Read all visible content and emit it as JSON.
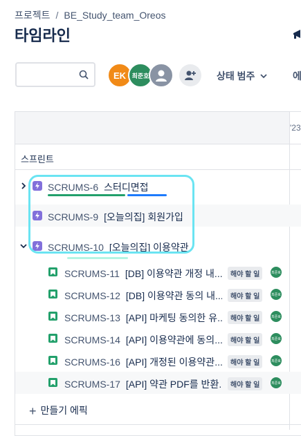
{
  "breadcrumb": {
    "projects": "프로젝트",
    "separator": "/",
    "project_name": "BE_Study_team_Oreos"
  },
  "page": {
    "title": "타임라인"
  },
  "toolbar": {
    "search_placeholder": "",
    "avatars": [
      {
        "initials": "EK",
        "color": "#f18a17"
      },
      {
        "initials": "최준호",
        "color": "#2d8d5e"
      },
      {
        "initials": "",
        "color": "#8993a4"
      }
    ],
    "status_filter": "상태 범주",
    "more_filter": "에"
  },
  "timeline": {
    "month_label": "'23",
    "sprint_label": "스프린트",
    "create_epic": "만들기 에픽",
    "epics": [
      {
        "key": "SCRUMS-6",
        "title": "스터디면접",
        "expanded": false
      },
      {
        "key": "SCRUMS-9",
        "title": "[오늘의집] 회원가입",
        "expanded": false
      },
      {
        "key": "SCRUMS-10",
        "title": "[오늘의집] 이용약관",
        "expanded": true
      }
    ],
    "issues": [
      {
        "key": "SCRUMS-11",
        "title": "[DB] 이용약관 개정 내...",
        "status": "해야 할 일",
        "assignee": "최준호"
      },
      {
        "key": "SCRUMS-12",
        "title": "[DB] 이용약관 동의 내...",
        "status": "해야 할 일",
        "assignee": "최준호"
      },
      {
        "key": "SCRUMS-13",
        "title": "[API] 마케팅 동의한 유...",
        "status": "해야 할 일",
        "assignee": "최준호"
      },
      {
        "key": "SCRUMS-14",
        "title": "[API] 이용약관에 동의...",
        "status": "해야 할 일",
        "assignee": "최준호"
      },
      {
        "key": "SCRUMS-16",
        "title": "[API] 개정된 이용약관...",
        "status": "해야 할 일",
        "assignee": "최준호"
      },
      {
        "key": "SCRUMS-17",
        "title": "[API] 약관 PDF를 반환...",
        "status": "해야 할 일",
        "assignee": "최준호"
      }
    ]
  },
  "colors": {
    "epic": "#8270db",
    "story": "#22a06b",
    "highlight": "#6ae4f2",
    "progress_done": "#22a06b",
    "progress_in_progress": "#1d7afc"
  }
}
